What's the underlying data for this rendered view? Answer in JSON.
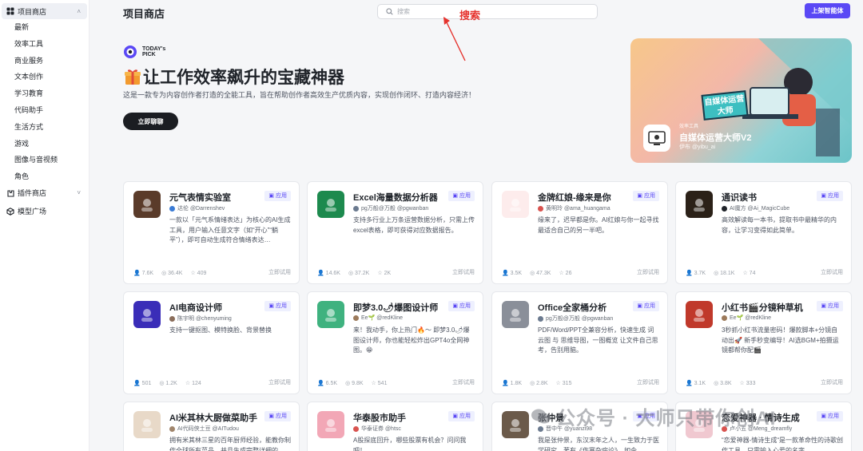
{
  "sidebar": {
    "store_group": "项目商店",
    "store_items": [
      "最新",
      "效率工具",
      "商业服务",
      "文本创作",
      "学习教育",
      "代码助手",
      "生活方式",
      "游戏",
      "图像与音视频",
      "角色"
    ],
    "plugin_group": "插件商店",
    "model_group": "模型广场"
  },
  "header": {
    "title": "项目商店",
    "search_placeholder": "搜索",
    "annotation": "搜索",
    "publish_button": "上架智能体"
  },
  "hero": {
    "logo_text": "TODAY's PICK",
    "title": "让工作效率飙升的宝藏神器",
    "subtitle": "这是一款专为内容创作者打造的全能工具，旨在帮助创作者高效生产优质内容，实现创作闭环、打造内容经济！",
    "button": "立即聊聊",
    "banner": {
      "sign_text": "自媒体运营大师",
      "tag": "效率工具",
      "name": "自媒体运营大师V2",
      "author": "伊布 @yibu_ai"
    }
  },
  "cards": [
    {
      "name": "元气表情实验室",
      "tag": "应用",
      "author": "达伦 @Darrenshev",
      "desc": "一款以「元气系情绪表达」为核心的AI生成工具，用户输入任意文字（如“开心”“躺平”），即可自动生成符合情绪表达…",
      "stats": [
        "7.6K",
        "36.4K",
        "409"
      ],
      "try": "立即试用",
      "thumb_color": "#5a3b2a",
      "thumb_icon": "emoji-avatar-icon",
      "dot": "#3a7bd5"
    },
    {
      "name": "Excel海量数据分析器",
      "tag": "应用",
      "author": "pg万般@万般 @pgwanban",
      "desc": "支持多行业上万条运营数据分析，只需上传excel表格，即可获得对应数据报告。",
      "stats": [
        "14.6K",
        "37.2K",
        "2K"
      ],
      "try": "立即试用",
      "thumb_color": "#1d8a4e",
      "thumb_icon": "spreadsheet-icon",
      "dot": "#6b7a8f"
    },
    {
      "name": "金牌红娘-缘来是你",
      "tag": "应用",
      "author": "黄明玲 @ama_huangama",
      "desc": "缘来了，迟早都是你。AI红娘与你一起寻找最适合自己的另一半吧。",
      "stats": [
        "3.5K",
        "47.3K",
        "26"
      ],
      "try": "立即试用",
      "thumb_color": "#fdecec",
      "thumb_icon": "heart-icon",
      "dot": "#d9534f"
    },
    {
      "name": "通识读书",
      "tag": "应用",
      "author": "AI魔方 @Ai_MagicCube",
      "desc": "高效解读每一本书，提取书中最精华的内容，让学习变得如此简单。",
      "stats": [
        "3.7K",
        "18.1K",
        "74"
      ],
      "try": "立即试用",
      "thumb_color": "#2b2118",
      "thumb_icon": "book-icon",
      "dot": "#1f2329"
    },
    {
      "name": "AI电商设计师",
      "tag": "应用",
      "author": "陈宇明 @chenyuming",
      "desc": "支持一键抠图、模特换脸、背景替换",
      "stats": [
        "501",
        "1.2K",
        "124"
      ],
      "try": "立即试用",
      "thumb_color": "#3a2db8",
      "thumb_icon": "monitor-icon",
      "dot": "#8a6d5a"
    },
    {
      "name": "即梦3.0🌶爆图设计师",
      "tag": "应用",
      "author": "Ee🌱 @redKline",
      "desc": "来！我动手，你上热门🔥～ 即梦3.0🌶爆图设计师，你也能轻松炸出GPT4o全网神图。😁",
      "stats": [
        "6.5K",
        "9.8K",
        "541"
      ],
      "try": "立即试用",
      "thumb_color": "#3fb27f",
      "thumb_icon": "poster-icon",
      "dot": "#9c7a5b"
    },
    {
      "name": "Office全家桶分析",
      "tag": "应用",
      "author": "pg万般@万般 @pgwanban",
      "desc": "PDF/Word/PPT全兼容分析，快速生成 词云图 与 思维导图，一图概览 让文件自己思考，告别用脑。",
      "stats": [
        "1.8K",
        "2.8K",
        "315"
      ],
      "try": "立即试用",
      "thumb_color": "#8a8f99",
      "thumb_icon": "office-icon",
      "dot": "#6b7a8f"
    },
    {
      "name": "小红书🎬分镜种草机",
      "tag": "应用",
      "author": "Ee🌱 @redKline",
      "desc": "3秒抓小红书流量密码！爆款脚本+分镜自动出🚀 新手秒变编导！AI选BGM+拍摄运镜都帮你配🎬",
      "stats": [
        "3.1K",
        "3.8K",
        "333"
      ],
      "try": "立即试用",
      "thumb_color": "#c0392b",
      "thumb_icon": "strawberry-icon",
      "dot": "#9c7a5b"
    },
    {
      "name": "AI米其林大厨做菜助手",
      "tag": "应用",
      "author": "AI代码侠土豆 @AITudou",
      "desc": "拥有米其林三星的百年厨师经验，能教你制作全球所有菜品，并且生成完整详细的…",
      "stats": [],
      "try": "",
      "thumb_color": "#e8d9c8",
      "thumb_icon": "chef-icon",
      "dot": "#a0856c"
    },
    {
      "name": "华泰股市助手",
      "tag": "应用",
      "author": "华泰证券 @htsc",
      "desc": "A股探底回升，哪些股票有机会？问问我吧！",
      "stats": [],
      "try": "",
      "thumb_color": "#f2a7b6",
      "thumb_icon": "avatar-girl-icon",
      "dot": "#d9534f"
    },
    {
      "name": "张仲景",
      "tag": "应用",
      "author": "晋中午 @yuanzi98",
      "desc": "我是张仲景，东汉末年之人，一生致力于医学研究，著有《伤寒杂病论》，如今…",
      "stats": [],
      "try": "",
      "thumb_color": "#6b5a4a",
      "thumb_icon": "portrait-icon",
      "dot": "#6b7a8f"
    },
    {
      "name": "恋爱神器 · 情诗生成",
      "tag": "应用",
      "author": "卢小五 @Meng_dreamfly",
      "desc": "“恋爱神器-情诗生成“是一款革命性的诗歌创作工具，只需输入心爱的名字…",
      "stats": [],
      "try": "",
      "thumb_color": "#f0c8d0",
      "thumb_icon": "love-avatar-icon",
      "dot": "#d9534f"
    }
  ],
  "watermark": "公众号 · 大师只带你创AI"
}
